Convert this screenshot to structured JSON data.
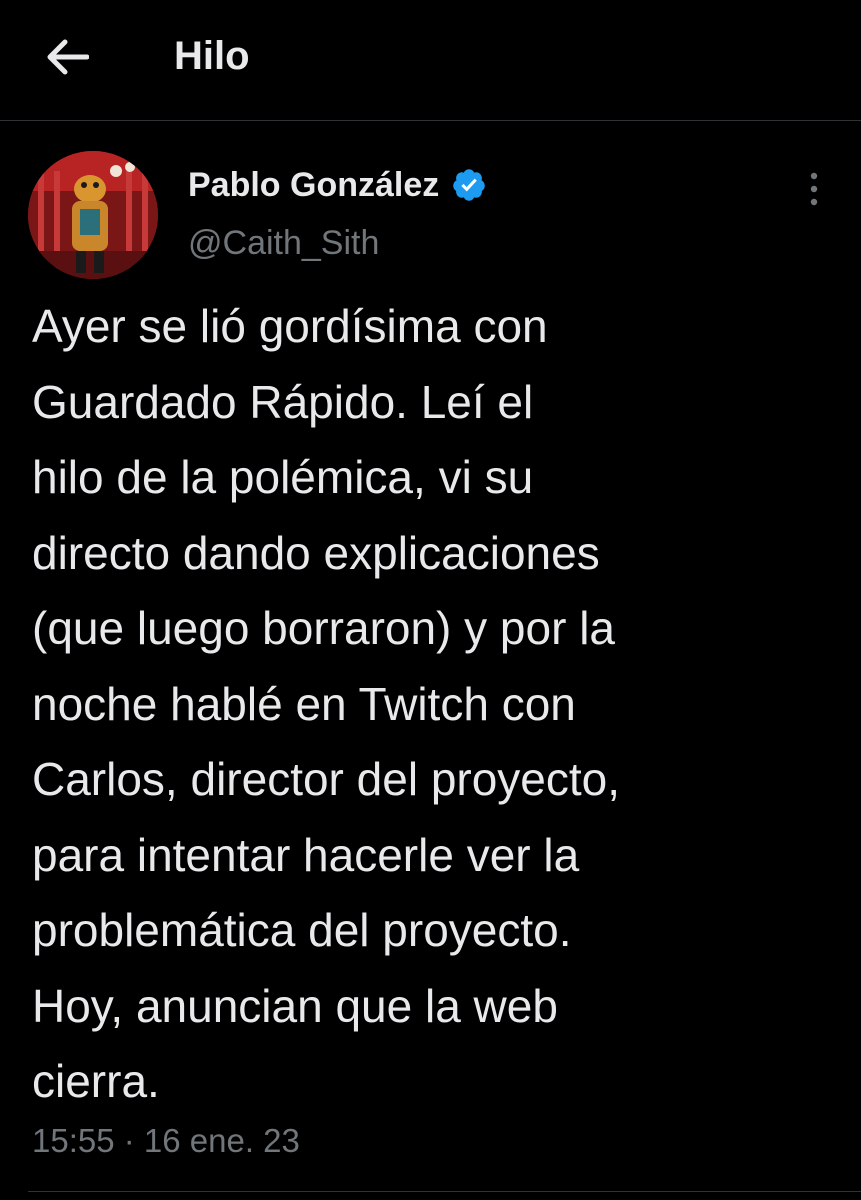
{
  "header": {
    "title": "Hilo",
    "back_icon": "arrow-left-icon"
  },
  "tweet": {
    "author_name": "Pablo González",
    "verified_icon": "verified-badge-icon",
    "handle": "@Caith_Sith",
    "text": "Ayer se lió gordísima con\nGuardado Rápido. Leí el\nhilo de la polémica, vi su\ndirecto dando explicaciones\n(que luego borraron) y por la\nnoche hablé en Twitch con\nCarlos, director del proyecto,\npara intentar hacerle ver la\nproblemática del proyecto.\nHoy, anuncian que la web\ncierra.",
    "timestamp": "15:55 · 16 ene. 23",
    "more_icon": "more-vertical-icon"
  },
  "colors": {
    "background": "#000000",
    "primary_text": "#e7e9ea",
    "secondary_text": "#71767b",
    "divider": "#2f3336",
    "verified_blue": "#1d9bf0"
  }
}
